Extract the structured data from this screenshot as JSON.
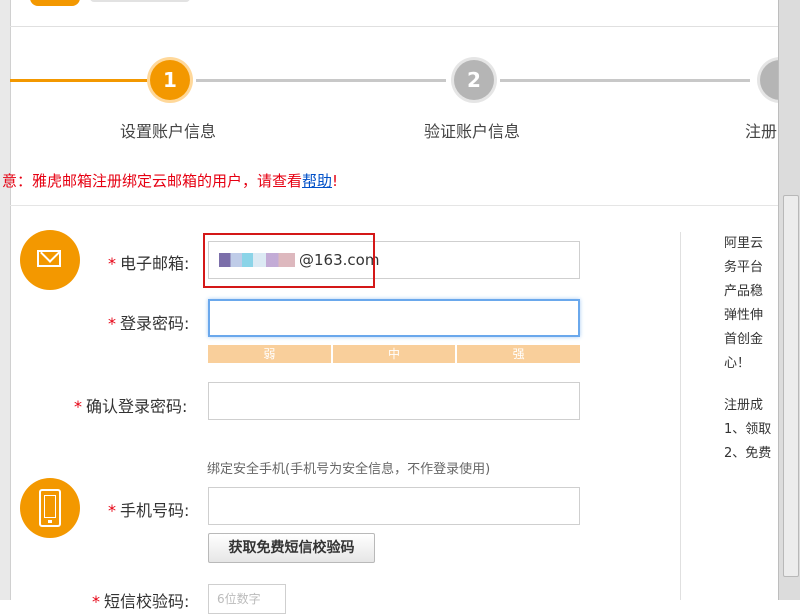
{
  "steps": [
    {
      "number": "1",
      "label": "设置账户信息",
      "state": "active"
    },
    {
      "number": "2",
      "label": "验证账户信息",
      "state": "pending"
    },
    {
      "number": "",
      "label": "注册",
      "state": "pending"
    }
  ],
  "notice": {
    "prefix": "意：雅虎邮箱注册绑定云邮箱的用户，请查看",
    "link": "帮助",
    "suffix": "!"
  },
  "form": {
    "email_label": "电子邮箱:",
    "email_value": "@163.com",
    "password_label": "登录密码:",
    "strength": [
      "弱",
      "中",
      "强"
    ],
    "confirm_label": "确认登录密码:",
    "phone_hint": "绑定安全手机(手机号为安全信息，不作登录使用)",
    "phone_label": "手机号码:",
    "sms_button": "获取免费短信校验码",
    "sms_label": "短信校验码:",
    "sms_placeholder": "6位数字",
    "required_mark": "*"
  },
  "sidebar": {
    "lines_a": [
      "阿里云",
      "务平台",
      "产品稳",
      "弹性伸",
      "首创金",
      "心！"
    ],
    "lines_b": [
      "注册成",
      "1、领取",
      "2、免费"
    ]
  },
  "colors": {
    "accent": "#f39800",
    "required": "#e60012",
    "link": "#0050c8",
    "highlight": "#d41818"
  },
  "icons": {
    "email": "mail-icon",
    "phone": "phone-icon"
  }
}
